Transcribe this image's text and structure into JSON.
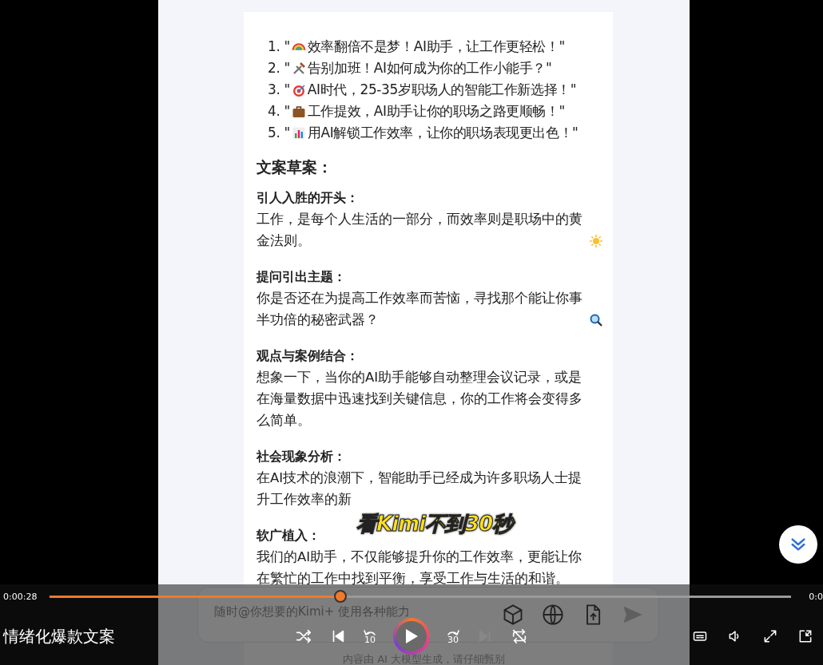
{
  "video": {
    "titles": [
      {
        "number": "1.",
        "lead": "\"",
        "text": "效率翻倍不是梦！AI助手，让工作更轻松！\""
      },
      {
        "number": "2.",
        "lead": "\"",
        "text": "告别加班！AI如何成为你的工作小能手？\""
      },
      {
        "number": "3.",
        "lead": "\"",
        "text": "AI时代，25-35岁职场人的智能工作新选择！\""
      },
      {
        "number": "4.",
        "lead": "\"",
        "text": "工作提效，AI助手让你的职场之路更顺畅！\""
      },
      {
        "number": "5.",
        "lead": "\"",
        "text": "用AI解锁工作效率，让你的职场表现更出色！\""
      }
    ],
    "heading": "文案草案：",
    "sections": [
      {
        "title": "引人入胜的开头：",
        "text": "工作，是每个人生活的一部分，而效率则是职场中的黄金法则。"
      },
      {
        "title": "提问引出主题：",
        "text": "你是否还在为提高工作效率而苦恼，寻找那个能让你事半功倍的秘密武器？"
      },
      {
        "title": "观点与案例结合：",
        "text": "想象一下，当你的AI助手能够自动整理会议记录，或是在海量数据中迅速找到关键信息，你的工作将会变得多么简单。"
      },
      {
        "title": "社会现象分析：",
        "text": "在AI技术的浪潮下，智能助手已经成为许多职场人士提升工作效率的新"
      },
      {
        "title": "软广植入：",
        "text": "我们的AI助手，不仅能够提升你的工作效率，更能让你在繁忙的工作中找到平衡，享受工作与生活的和谐。"
      }
    ],
    "chat_input": {
      "placeholder": "随时@你想要的Kimi+ 使用各种能力"
    },
    "disclaimer": "内容由 AI 大模型生成，请仔细甄别",
    "subtitle": "看Kimi不到30秒"
  },
  "player": {
    "rewind": "10",
    "forward": "30",
    "elapsed": "0:00:28",
    "total": "0:0",
    "level": 0.392,
    "title": "情绪化爆款文案"
  }
}
